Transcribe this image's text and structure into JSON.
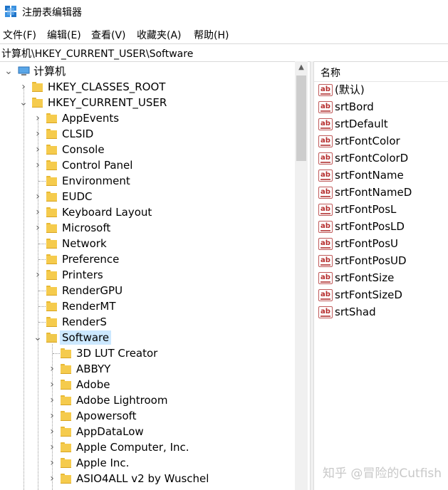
{
  "window": {
    "title": "注册表编辑器",
    "icon": "registry-editor-icon"
  },
  "menu": {
    "items": [
      "文件(F)",
      "编辑(E)",
      "查看(V)",
      "收藏夹(A)",
      "帮助(H)"
    ]
  },
  "address": {
    "path": "计算机\\HKEY_CURRENT_USER\\Software"
  },
  "tree": {
    "root": "计算机",
    "hives": [
      "HKEY_CLASSES_ROOT",
      "HKEY_CURRENT_USER"
    ],
    "hkcu_children": [
      {
        "label": "AppEvents",
        "expandable": true
      },
      {
        "label": "CLSID",
        "expandable": true
      },
      {
        "label": "Console",
        "expandable": true
      },
      {
        "label": "Control Panel",
        "expandable": true
      },
      {
        "label": "Environment",
        "expandable": false
      },
      {
        "label": "EUDC",
        "expandable": true
      },
      {
        "label": "Keyboard Layout",
        "expandable": true
      },
      {
        "label": "Microsoft",
        "expandable": true
      },
      {
        "label": "Network",
        "expandable": false
      },
      {
        "label": "Preference",
        "expandable": false
      },
      {
        "label": "Printers",
        "expandable": true
      },
      {
        "label": "RenderGPU",
        "expandable": false
      },
      {
        "label": "RenderMT",
        "expandable": false
      },
      {
        "label": "RenderS",
        "expandable": false
      },
      {
        "label": "Software",
        "expandable": true,
        "selected": true
      }
    ],
    "software_children": [
      {
        "label": "3D LUT Creator",
        "expandable": false
      },
      {
        "label": "ABBYY",
        "expandable": true
      },
      {
        "label": "Adobe",
        "expandable": true
      },
      {
        "label": "Adobe Lightroom",
        "expandable": true
      },
      {
        "label": "Apowersoft",
        "expandable": true
      },
      {
        "label": "AppDataLow",
        "expandable": true
      },
      {
        "label": "Apple Computer, Inc.",
        "expandable": true
      },
      {
        "label": "Apple Inc.",
        "expandable": true
      },
      {
        "label": "ASIO4ALL v2 by Wuschel",
        "expandable": true
      }
    ]
  },
  "values": {
    "column_name": "名称",
    "items": [
      "(默认)",
      "srtBord",
      "srtDefault",
      "srtFontColor",
      "srtFontColorD",
      "srtFontName",
      "srtFontNameD",
      "srtFontPosL",
      "srtFontPosLD",
      "srtFontPosU",
      "srtFontPosUD",
      "srtFontSize",
      "srtFontSizeD",
      "srtShad"
    ],
    "icon_label": "ab"
  },
  "watermark": "知乎 @冒险的Cutfish",
  "colors": {
    "selection": "#cce8ff",
    "folder": "#f5cb4d",
    "value_icon": "#b52d2d"
  }
}
